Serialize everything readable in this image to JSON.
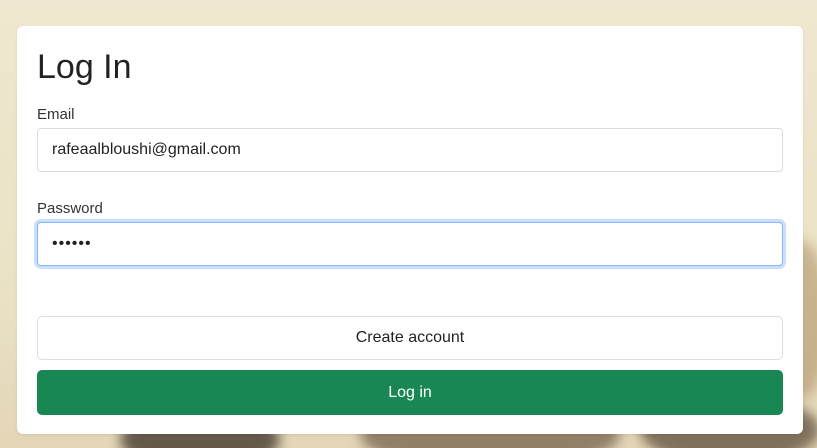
{
  "login": {
    "title": "Log In",
    "email_label": "Email",
    "email_value": "rafeaalbloushi@gmail.com",
    "password_label": "Password",
    "password_value": "••••••",
    "create_account_label": "Create account",
    "login_label": "Log in"
  },
  "colors": {
    "primary_button": "#198754",
    "focus_ring": "#86b7fe",
    "card_background": "#ffffff"
  }
}
